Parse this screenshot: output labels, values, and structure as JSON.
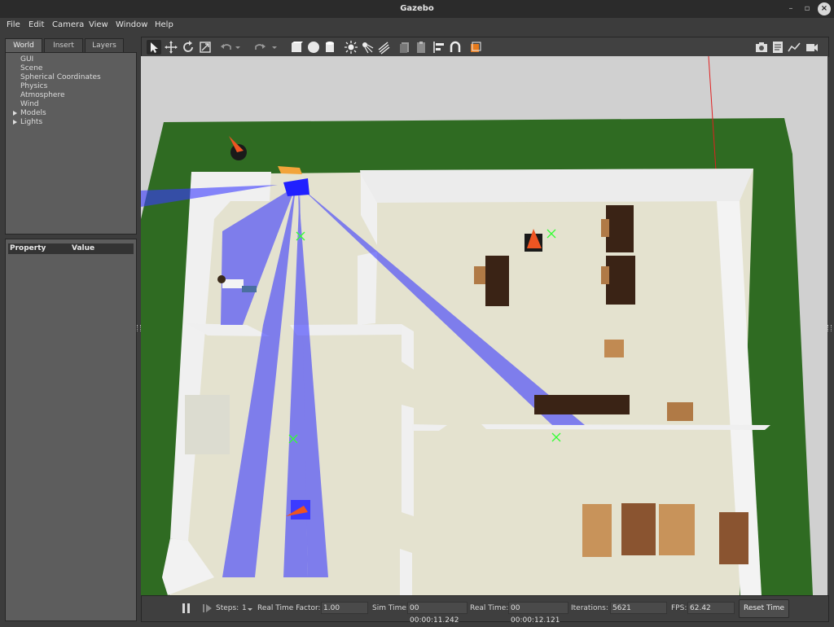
{
  "window": {
    "title": "Gazebo"
  },
  "menu": [
    "File",
    "Edit",
    "Camera",
    "View",
    "Window",
    "Help"
  ],
  "left_panel": {
    "tabs": [
      "World",
      "Insert",
      "Layers"
    ],
    "active_tab": "World",
    "tree": [
      "GUI",
      "Scene",
      "Spherical Coordinates",
      "Physics",
      "Atmosphere",
      "Wind",
      "Models",
      "Lights"
    ],
    "properties": {
      "col1": "Property",
      "col2": "Value"
    }
  },
  "toolbar": {
    "icons": [
      "select-arrow-icon",
      "translate-icon",
      "rotate-icon",
      "scale-icon",
      "undo-icon",
      "redo-icon",
      "box-icon",
      "sphere-icon",
      "cylinder-icon",
      "point-light-icon",
      "spot-light-icon",
      "directional-light-icon",
      "copy-icon",
      "paste-icon",
      "align-icon",
      "snap-icon",
      "view-angle-icon",
      "screenshot-icon",
      "log-icon",
      "plot-icon",
      "video-icon"
    ]
  },
  "bottom_bar": {
    "pause_icon": "pause-icon",
    "step_icon": "step-icon",
    "steps_label": "Steps:",
    "steps_value": "1",
    "rtf_label": "Real Time Factor:",
    "rtf_value": "1.00",
    "sim_time_label": "Sim Time:",
    "sim_time_value": "00 00:00:11.242",
    "real_time_label": "Real Time:",
    "real_time_value": "00 00:00:12.121",
    "iterations_label": "Iterations:",
    "iterations_value": "5621",
    "fps_label": "FPS:",
    "fps_value": "62.42",
    "reset_label": "Reset Time"
  },
  "scene": {
    "grass_color": "#2f6b22",
    "floor_color": "#e4e2cf",
    "wall_color": "#f2f2f2",
    "laser_color": "#3b3bff",
    "furniture_color": "#3a2315",
    "wood_color": "#b07a46"
  }
}
